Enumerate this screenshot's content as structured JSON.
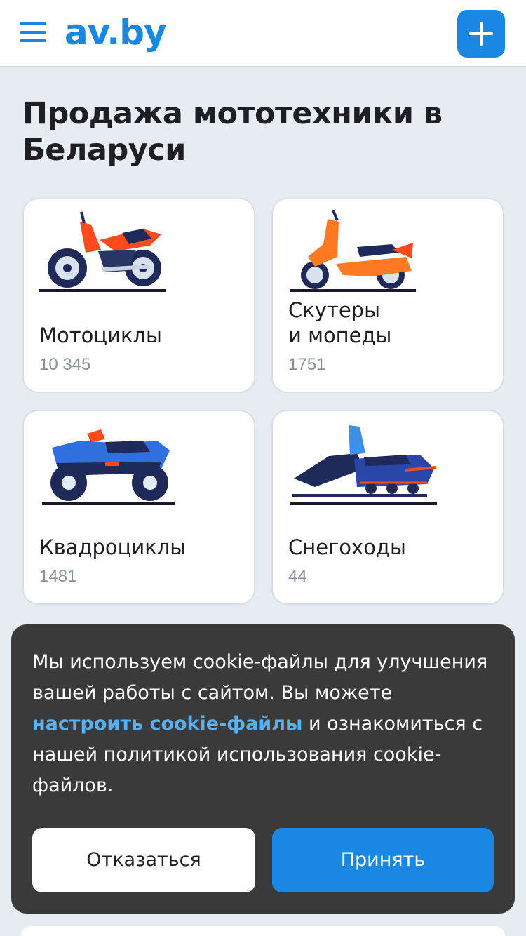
{
  "header": {
    "logo": "av.by",
    "menu_icon": "hamburger-menu-icon",
    "add_icon": "plus-icon",
    "brand_color": "#1a88e2"
  },
  "page": {
    "title": "Продажа мототехники в Беларуси"
  },
  "categories": [
    {
      "name": "Мотоциклы",
      "count": "10 345",
      "icon": "motorcycle-icon"
    },
    {
      "name": "Скутеры\nи мопеды",
      "count": "1751",
      "icon": "scooter-icon"
    },
    {
      "name": "Квадроциклы",
      "count": "1481",
      "icon": "atv-icon"
    },
    {
      "name": "Снегоходы",
      "count": "44",
      "icon": "snowmobile-icon"
    }
  ],
  "cookie": {
    "text_1": "Мы используем cookie-файлы для улучшения вашей работы с сайтом. Вы можете ",
    "link": "настроить cookie-файлы",
    "text_2": " и ознакомиться с нашей политикой использования cookie-файлов.",
    "decline": "Отказаться",
    "accept": "Принять"
  }
}
